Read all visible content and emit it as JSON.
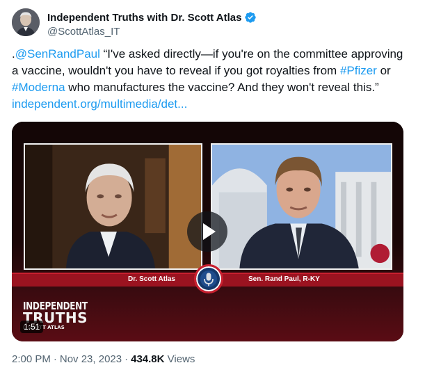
{
  "author": {
    "display_name": "Independent Truths with Dr. Scott Atlas",
    "handle": "@ScottAtlas_IT",
    "verified": true,
    "avatar_icon": "profile-photo"
  },
  "tweet": {
    "prefix": ".",
    "mention": "@SenRandPaul",
    "text_1": " “I've asked directly—if you're on the committee approving a vaccine, wouldn't you have to reveal if you got royalties from ",
    "hashtag_1": "#Pfizer",
    "text_2": " or ",
    "hashtag_2": "#Moderna",
    "text_3": " who manufactures the vaccine? And they won't reveal this.” ",
    "link": "independent.org/multimedia/det..."
  },
  "media": {
    "left_name": "Dr. Scott Atlas",
    "right_name": "Sen. Rand Paul, R-KY",
    "logo_line1": "INDEPENDENT",
    "logo_line2": "TRUTHS",
    "logo_line3": "L SCOTT ATLAS",
    "duration": "1:51",
    "play_icon": "play-icon"
  },
  "meta": {
    "time": "2:00 PM",
    "date": "Nov 23, 2023",
    "views_count": "434.8K",
    "views_label": "Views"
  },
  "colors": {
    "link": "#1d9bf0",
    "verified": "#1d9bf0",
    "banner": "#9b1320",
    "secondary_text": "#536471"
  }
}
